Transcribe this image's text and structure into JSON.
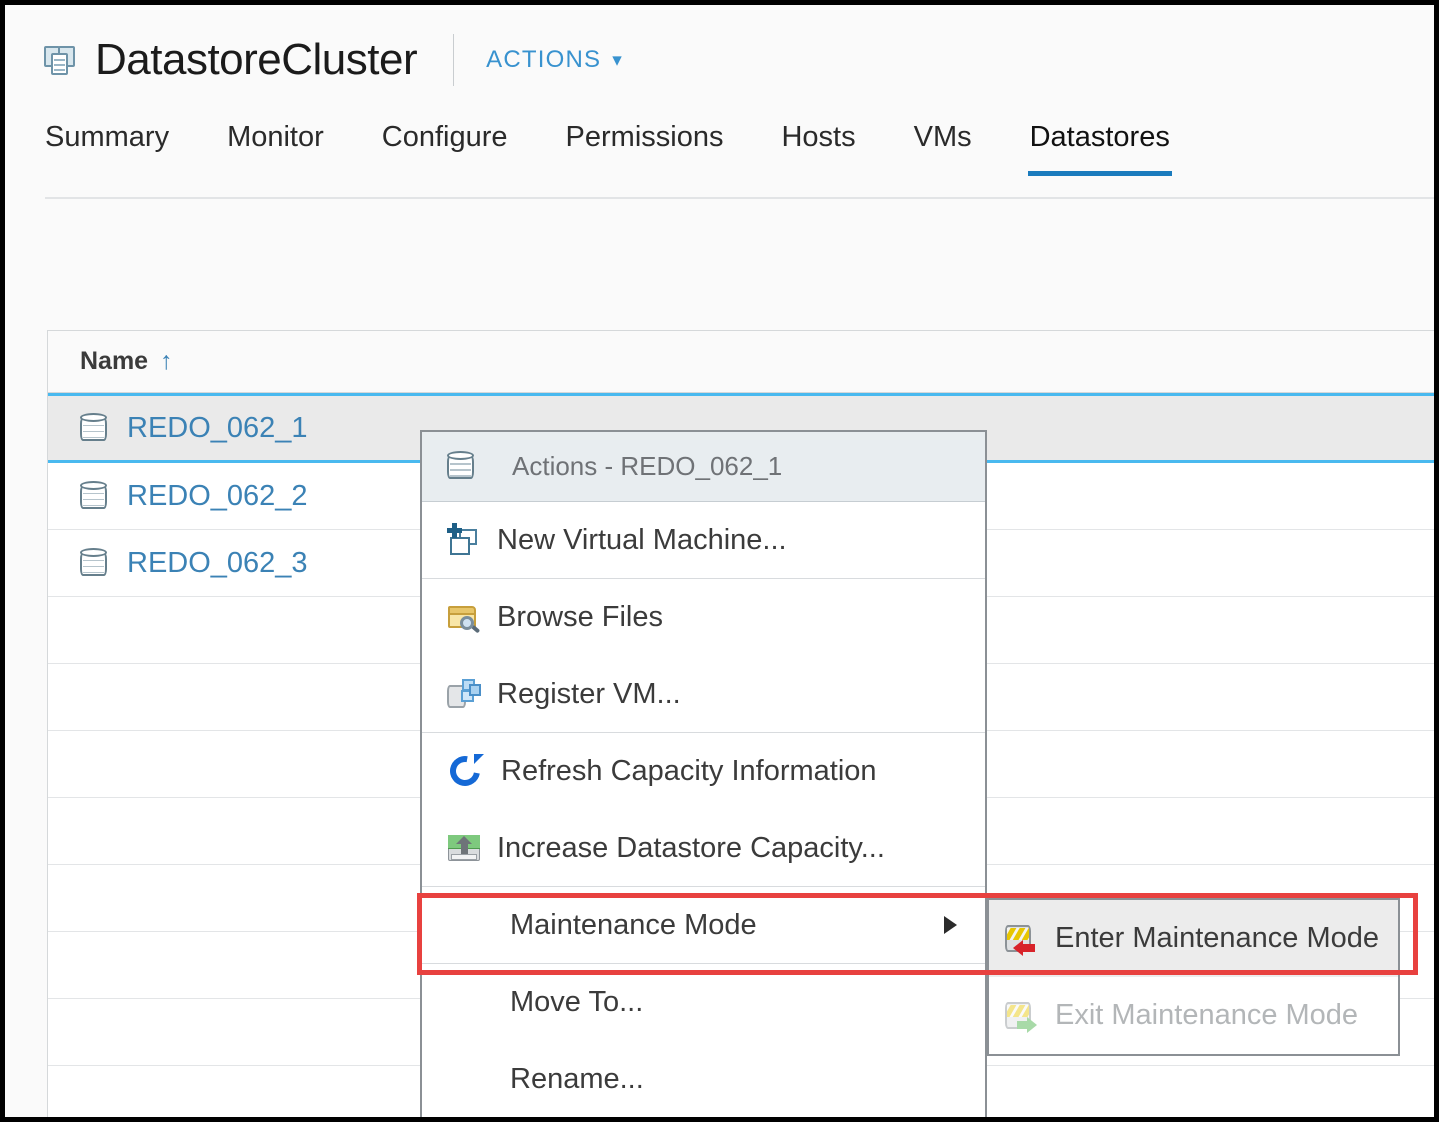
{
  "header": {
    "icon": "datastore-cluster-icon",
    "title": "DatastoreCluster",
    "actions_label": "ACTIONS",
    "actions_caret": "⌄"
  },
  "tabs": [
    {
      "label": "Summary",
      "active": false
    },
    {
      "label": "Monitor",
      "active": false
    },
    {
      "label": "Configure",
      "active": false
    },
    {
      "label": "Permissions",
      "active": false
    },
    {
      "label": "Hosts",
      "active": false
    },
    {
      "label": "VMs",
      "active": false
    },
    {
      "label": "Datastores",
      "active": true
    }
  ],
  "table": {
    "columns": [
      {
        "label": "Name",
        "sort": "↑",
        "sorted": "ascending"
      }
    ],
    "rows": [
      {
        "name": "REDO_062_1",
        "icon": "datastore-icon",
        "selected": true
      },
      {
        "name": "REDO_062_2",
        "icon": "datastore-icon",
        "selected": false
      },
      {
        "name": "REDO_062_3",
        "icon": "datastore-icon",
        "selected": false
      }
    ]
  },
  "context_menu": {
    "header_label": "Actions - REDO_062_1",
    "header_icon": "datastore-icon",
    "items": [
      {
        "label": "New Virtual Machine...",
        "icon": "new-virtual-machine-icon",
        "submenu": false,
        "disabled": false
      },
      {
        "label": "Browse Files",
        "icon": "browse-files-icon",
        "submenu": false,
        "disabled": false
      },
      {
        "label": "Register VM...",
        "icon": "register-vm-icon",
        "submenu": false,
        "disabled": false
      },
      {
        "label": "Refresh Capacity Information",
        "icon": "refresh-icon",
        "submenu": false,
        "disabled": false
      },
      {
        "label": "Increase Datastore Capacity...",
        "icon": "increase-capacity-icon",
        "submenu": false,
        "disabled": false
      },
      {
        "label": "Maintenance Mode",
        "icon": "none",
        "submenu": true,
        "disabled": false,
        "arrow": "▶"
      },
      {
        "label": "Move To...",
        "icon": "none",
        "submenu": false,
        "disabled": false
      },
      {
        "label": "Rename...",
        "icon": "none",
        "submenu": false,
        "disabled": false
      }
    ]
  },
  "submenu": {
    "parent": "Maintenance Mode",
    "items": [
      {
        "label": "Enter Maintenance Mode",
        "icon": "enter-maintenance-mode-icon",
        "disabled": false,
        "hovered": true
      },
      {
        "label": "Exit Maintenance Mode",
        "icon": "exit-maintenance-mode-icon",
        "disabled": true,
        "hovered": false
      }
    ]
  },
  "annotations": [
    {
      "type": "highlight-rectangle",
      "color": "#e8413f",
      "targets": [
        "Maintenance Mode",
        "Enter Maintenance Mode"
      ]
    }
  ],
  "colors": {
    "accent_blue": "#3b82b5",
    "tab_active_underline": "#1a7bbd",
    "selection_border": "#49b9ef",
    "selection_fill": "#eaeaea",
    "annotation_red": "#e8413f",
    "link_blue": "#3892cf"
  }
}
